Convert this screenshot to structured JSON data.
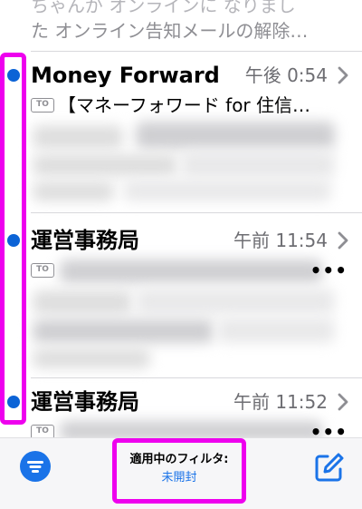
{
  "top_partial": {
    "line1": "ちゃんが オンラインに なりまし",
    "line2": "た オンライン告知メールの解除…"
  },
  "mails": [
    {
      "sender": "Money Forward",
      "time": "午後 0:54",
      "to_badge": "TO",
      "subject": "【マネーフォワード for 住信…",
      "unread": true
    },
    {
      "sender": "運営事務局",
      "time": "午前 11:54",
      "to_badge": "TO",
      "subject": "",
      "more": "•••",
      "unread": true
    },
    {
      "sender": "運営事務局",
      "time": "午前 11:52",
      "to_badge": "TO",
      "subject": "",
      "more": "•••",
      "unread": true
    }
  ],
  "toolbar": {
    "filter_label": "適用中のフィルタ:",
    "filter_value": "未開封"
  },
  "colors": {
    "accent": "#1a73e8",
    "unread_dot": "#0b63d6",
    "highlight": "#ee00ee",
    "secondary_text": "#6d6d72"
  }
}
